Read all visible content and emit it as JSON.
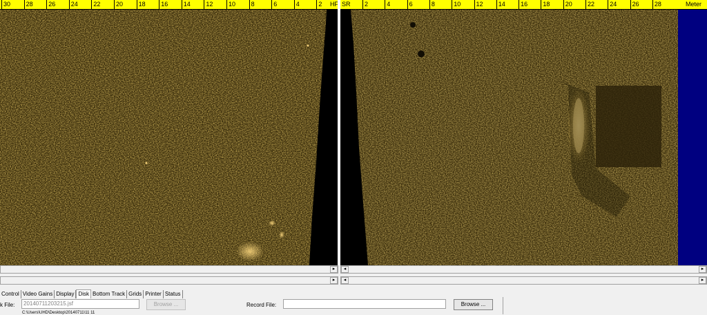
{
  "left_ruler": {
    "ticks": [
      "30",
      "28",
      "26",
      "24",
      "22",
      "20",
      "18",
      "16",
      "14",
      "12",
      "10",
      "8",
      "6",
      "4",
      "2"
    ],
    "end_label": "HF"
  },
  "right_ruler": {
    "start_label": "SR",
    "ticks": [
      "2",
      "4",
      "6",
      "8",
      "10",
      "12",
      "14",
      "16",
      "18",
      "20",
      "22",
      "24",
      "26",
      "28"
    ],
    "end_label": "Meter"
  },
  "tabs": [
    "Control",
    "Video Gains",
    "Display",
    "Disk",
    "Bottom Track",
    "Grids",
    "Printer",
    "Status"
  ],
  "active_tab": "Disk",
  "disk": {
    "playback_label": "k File:",
    "playback_value": "20140711203215.jsf",
    "browse_left": "Browse ...",
    "record_label": "Record File:",
    "record_value": "",
    "browse_right": "Browse ...",
    "path_text": "C:\\Users\\UHD\\Desktop\\20140711\\11 11"
  },
  "scroll_arrows": {
    "right": "▸",
    "left": "◂"
  },
  "colors": {
    "ruler": "#ffff00",
    "sonar_bright": "#f6d27a",
    "sonar_dark": "#000000",
    "margin": "#000080"
  }
}
